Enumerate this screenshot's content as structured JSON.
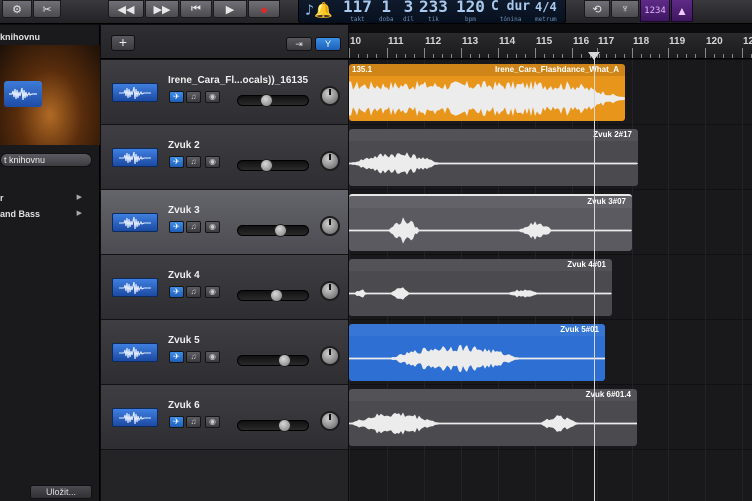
{
  "toolbar": {
    "lcd": {
      "bar": "117",
      "bar_label": "takt",
      "beat": "1",
      "beat_label": "doba",
      "div": "3",
      "div_label": "díl",
      "tick": "233",
      "tick_label": "tik",
      "tempo": "120",
      "tempo_label": "bpm",
      "key": "C dur",
      "key_label": "tónina",
      "signature": "4/4",
      "signature_label": "metrum"
    },
    "count_in": "1234"
  },
  "library": {
    "title": "knihovnu",
    "button": "t knihovnu",
    "items": [
      {
        "label": "r"
      },
      {
        "label": "and Bass"
      }
    ],
    "save_button": "Uložit..."
  },
  "ruler": {
    "marks": [
      "10",
      "111",
      "112",
      "113",
      "114",
      "115",
      "116",
      "117",
      "118",
      "119",
      "120",
      "12"
    ]
  },
  "tracks": [
    {
      "name": "Irene_Cara_Fl...ocals))_16135",
      "selected": false,
      "region": {
        "label": "Irene_Cara_Flashdance_What_A",
        "left_label": "135.1",
        "color": "#e8951c"
      }
    },
    {
      "name": "Zvuk 2",
      "selected": false,
      "region": {
        "label": "Zvuk 2#17",
        "left_label": "",
        "color": "#4a4a4f"
      }
    },
    {
      "name": "Zvuk 3",
      "selected": true,
      "region": {
        "label": "Zvuk 3#07",
        "left_label": "",
        "color": "#5a5a60"
      }
    },
    {
      "name": "Zvuk 4",
      "selected": false,
      "region": {
        "label": "Zvuk 4#01",
        "left_label": "",
        "color": "#4a4a4f"
      }
    },
    {
      "name": "Zvuk 5",
      "selected": false,
      "region": {
        "label": "Zvuk 5#01",
        "left_label": "",
        "color": "#2e6fd3"
      }
    },
    {
      "name": "Zvuk 6",
      "selected": false,
      "region": {
        "label": "Zvuk 6#01.4",
        "left_label": "",
        "color": "#4a4a4f"
      }
    }
  ]
}
